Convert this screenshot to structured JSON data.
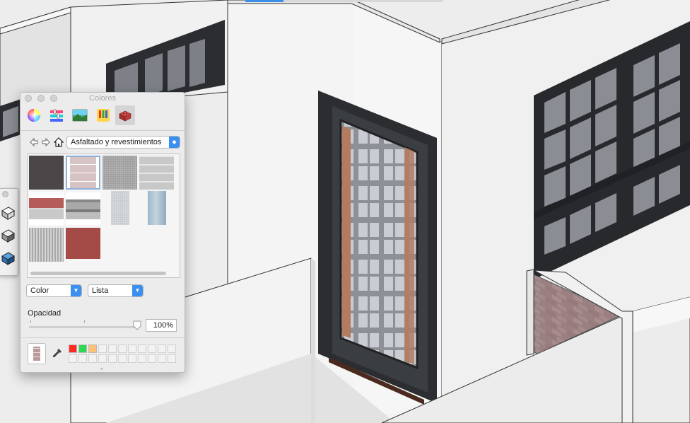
{
  "panel": {
    "title": "Colores",
    "modes": [
      {
        "icon": "color-wheel-icon",
        "active": false
      },
      {
        "icon": "color-sliders-icon",
        "active": false
      },
      {
        "icon": "image-palette-icon",
        "active": false
      },
      {
        "icon": "crayons-icon",
        "active": false
      },
      {
        "icon": "brick-texture-icon",
        "active": true
      }
    ],
    "nav": {
      "back_icon": "back-arrow-icon",
      "forward_icon": "forward-arrow-icon",
      "home_icon": "home-icon",
      "collection": "Asfaltado y revestimientos"
    },
    "materials_count": 10,
    "selected_index": 1,
    "color_mode_select": "Color",
    "view_select": "Lista",
    "opacity_label": "Opacidad",
    "opacity_value": "100%",
    "opacity_level": 1.0,
    "well_colors": [
      "#ff2a22",
      "#2bd956",
      "#ffc07a"
    ],
    "eyedropper_icon": "eyedropper-icon"
  },
  "toolbar": {
    "buttons": [
      "style-icon-1",
      "style-icon-2",
      "style-icon-3"
    ]
  },
  "colors": {
    "accent": "#3b8ff0",
    "panel_bg": "#ececec",
    "wall_light": "#f2f2f2",
    "frame_dark": "#2b2d30",
    "brick_red": "#a94f4a"
  }
}
